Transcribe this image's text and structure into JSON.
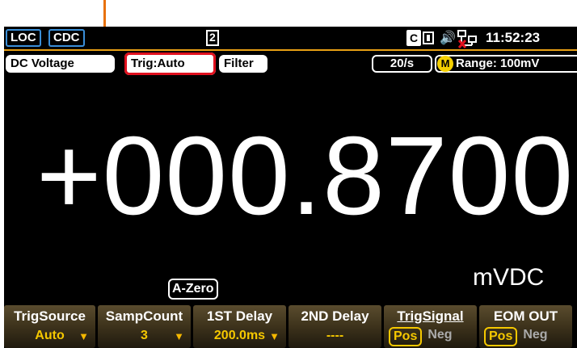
{
  "status_bar": {
    "loc": "LOC",
    "cdc": "CDC",
    "memory_slot": "2",
    "time": "11:52:23"
  },
  "function_bar": {
    "measurement": "DC Voltage",
    "trigger": "Trig:Auto",
    "filter": "Filter",
    "rate": "20/s",
    "range_badge": "M",
    "range": "Range: 100mV"
  },
  "display": {
    "reading": "+000.8700",
    "azero": "A-Zero",
    "unit": "mVDC"
  },
  "softkeys": [
    {
      "label": "TrigSource",
      "value": "Auto",
      "has_arrow": true
    },
    {
      "label": "SampCount",
      "value": "3",
      "has_arrow": true
    },
    {
      "label": "1ST Delay",
      "value": "200.0ms",
      "has_arrow": true
    },
    {
      "label": "2ND Delay",
      "value": "----",
      "has_arrow": false
    },
    {
      "label": "TrigSignal",
      "options": [
        "Pos",
        "Neg"
      ],
      "selected": "Pos"
    },
    {
      "label": "EOM OUT",
      "options": [
        "Pos",
        "Neg"
      ],
      "selected": "Pos"
    }
  ],
  "colors": {
    "callout": "#e8710a",
    "highlight_box": "#e0101e",
    "accent_yellow": "#f5c800"
  }
}
